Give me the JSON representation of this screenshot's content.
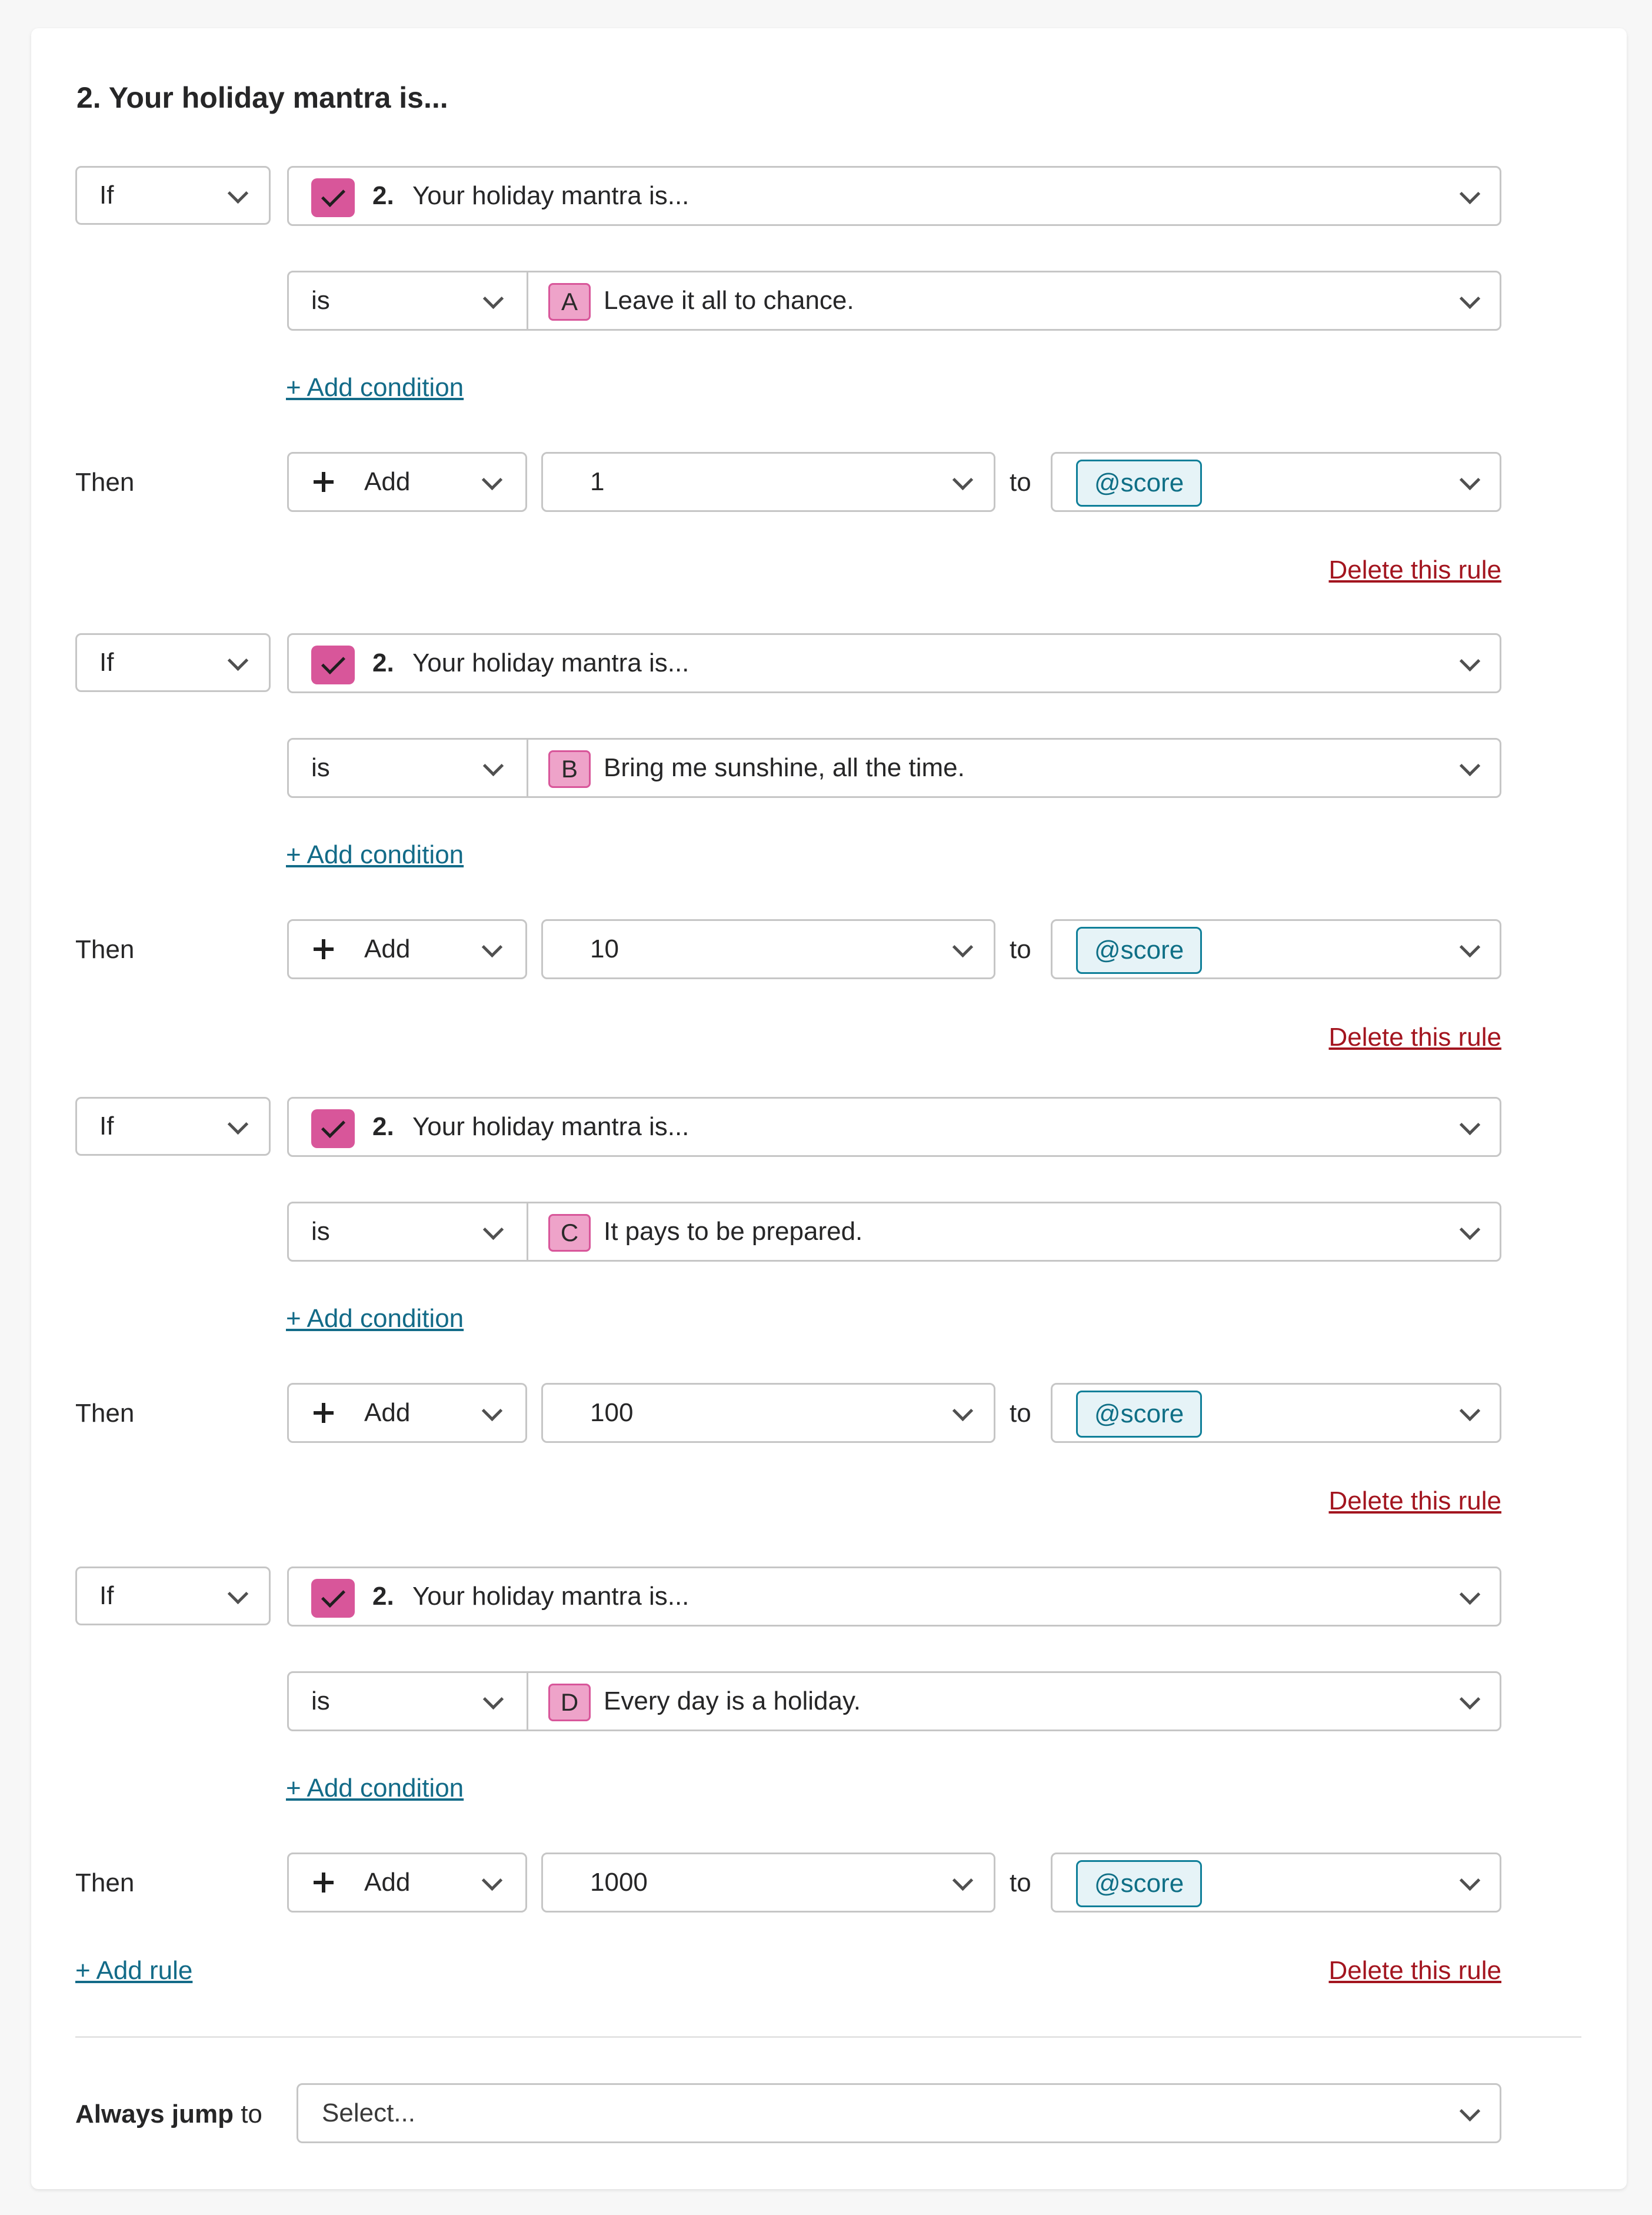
{
  "section": {
    "title": "2.  Your holiday mantra is..."
  },
  "rules": [
    {
      "if_label": "If",
      "question_number": "2.",
      "question_text": "Your holiday mantra is...",
      "operator": "is",
      "answer_letter": "A",
      "answer_text": "Leave it all to chance.",
      "add_condition": "+ Add condition",
      "then_label": "Then",
      "action": "Add",
      "value": "1",
      "to_label": "to",
      "variable": "@score",
      "delete": "Delete this rule"
    },
    {
      "if_label": "If",
      "question_number": "2.",
      "question_text": "Your holiday mantra is...",
      "operator": "is",
      "answer_letter": "B",
      "answer_text": "Bring me sunshine, all the time.",
      "add_condition": "+ Add condition",
      "then_label": "Then",
      "action": "Add",
      "value": "10",
      "to_label": "to",
      "variable": "@score",
      "delete": "Delete this rule"
    },
    {
      "if_label": "If",
      "question_number": "2.",
      "question_text": "Your holiday mantra is...",
      "operator": "is",
      "answer_letter": "C",
      "answer_text": "It pays to be prepared.",
      "add_condition": "+ Add condition",
      "then_label": "Then",
      "action": "Add",
      "value": "100",
      "to_label": "to",
      "variable": "@score",
      "delete": "Delete this rule"
    },
    {
      "if_label": "If",
      "question_number": "2.",
      "question_text": "Your holiday mantra is...",
      "operator": "is",
      "answer_letter": "D",
      "answer_text": "Every day is a holiday.",
      "add_condition": "+ Add condition",
      "then_label": "Then",
      "action": "Add",
      "value": "1000",
      "to_label": "to",
      "variable": "@score",
      "delete": "Delete this rule"
    }
  ],
  "add_rule": "+ Add rule",
  "always_jump": {
    "label_bold": "Always jump",
    "label_rest": " to",
    "placeholder": "Select..."
  },
  "colors": {
    "accent_pink": "#d8569a",
    "link_teal": "#136b88",
    "delete_red": "#a3151f",
    "tag_teal": "#0f7f99"
  }
}
